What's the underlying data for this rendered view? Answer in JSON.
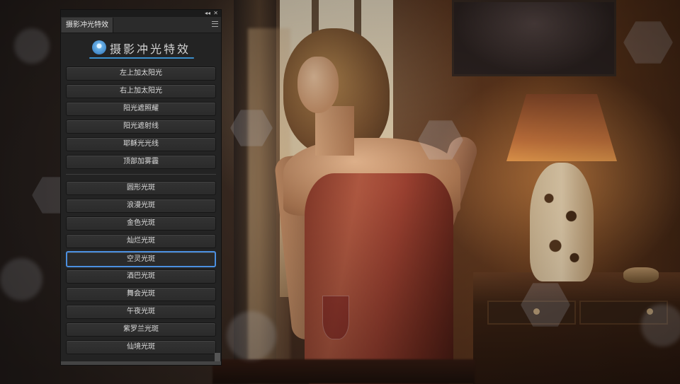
{
  "panel": {
    "tab_label": "摄影冲光特效",
    "collapse_icon": "collapse-icon",
    "close_icon": "close-icon",
    "menu_icon": "menu-icon",
    "logo_text": "摄影冲光特效",
    "accent_color": "#4b8fe0",
    "buttons_group1": [
      "左上加太阳光",
      "右上加太阳光",
      "阳光遮照耀",
      "阳光遮射线",
      "耶稣光光线",
      "顶部加雾霾"
    ],
    "buttons_group2": [
      "圆形光斑",
      "浪漫光斑",
      "金色光斑",
      "灿烂光斑",
      "空灵光斑",
      "酒巴光斑",
      "舞会光斑",
      "午夜光斑",
      "紫罗兰光斑",
      "仙境光斑"
    ],
    "selected_button": "空灵光斑"
  }
}
